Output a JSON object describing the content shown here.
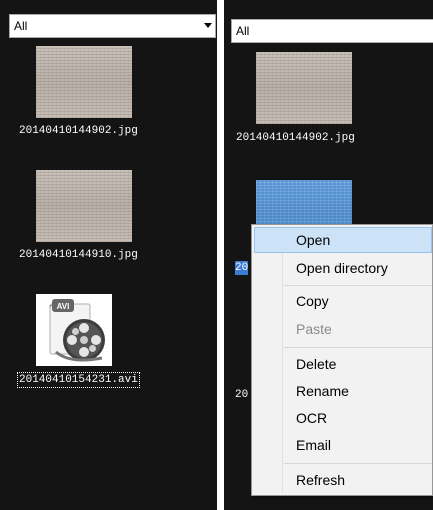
{
  "left_pane": {
    "filter_value": "All",
    "files": [
      {
        "name": "20140410144902.jpg"
      },
      {
        "name": "20140410144910.jpg"
      },
      {
        "name": "20140410154231.avi",
        "icon": "avi-film-reel-icon",
        "badge": "AVI"
      }
    ]
  },
  "right_pane": {
    "filter_value": "All",
    "files": [
      {
        "name": "20140410144902.jpg"
      },
      {
        "name": "20"
      },
      {
        "name": "20"
      }
    ]
  },
  "context_menu": {
    "items": [
      {
        "label": "Open",
        "highlighted": true,
        "disabled": false
      },
      {
        "label": "Open directory",
        "disabled": false
      },
      {
        "label": "Copy",
        "disabled": false
      },
      {
        "label": "Paste",
        "disabled": true
      },
      {
        "label": "Delete",
        "disabled": false
      },
      {
        "label": "Rename",
        "disabled": false
      },
      {
        "label": "OCR",
        "disabled": false
      },
      {
        "label": "Email",
        "disabled": false
      },
      {
        "label": "Refresh",
        "disabled": false
      }
    ]
  },
  "colors": {
    "pane_background": "#141414",
    "selection": "#3a7bd5",
    "menu_highlight": "#cce3f7"
  }
}
